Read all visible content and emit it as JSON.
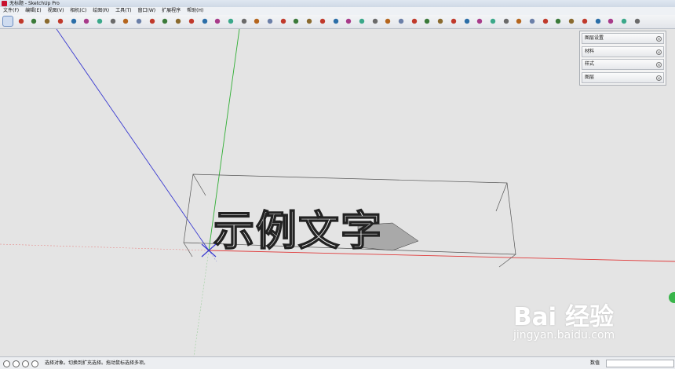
{
  "window": {
    "title": "无标题 - SketchUp Pro"
  },
  "menu": [
    {
      "label": "文件(F)"
    },
    {
      "label": "编辑(E)"
    },
    {
      "label": "视图(V)"
    },
    {
      "label": "相机(C)"
    },
    {
      "label": "绘图(R)"
    },
    {
      "label": "工具(T)"
    },
    {
      "label": "窗口(W)"
    },
    {
      "label": "扩展程序"
    },
    {
      "label": "帮助(H)"
    }
  ],
  "toolbar_icons": [
    "select-arrow-icon",
    "eraser-icon",
    "pencil-icon",
    "dropdown-icon",
    "arc-icon",
    "dropdown-icon",
    "rectangle-icon",
    "dropdown-icon",
    "push-pull-icon",
    "move-icon",
    "rotate-icon",
    "scale-icon",
    "offset-icon",
    "tape-measure-icon",
    "dimension-icon",
    "protractor-icon",
    "orbit-icon",
    "pan-icon",
    "zoom-icon",
    "zoom-extents-icon",
    "warehouse-icon",
    "components-icon",
    "paint-bucket-icon",
    "intersect-icon",
    "views-icon",
    "views-icon",
    "views-icon",
    "views-icon",
    "views-icon",
    "section-icon",
    "section-icon",
    "sandbox-icon",
    "sandbox-icon",
    "sandbox-icon",
    "sandbox-icon",
    "sandbox-icon",
    "sandbox-icon",
    "sandbox-icon",
    "style-icon",
    "style-icon",
    "style-icon",
    "style-icon",
    "style-icon",
    "style-icon",
    "style-icon",
    "style-icon",
    "layers-icon",
    "extension-icon",
    "sketchup-icon"
  ],
  "tray": {
    "panels": [
      {
        "label": "图层设置"
      },
      {
        "label": "材料"
      },
      {
        "label": "样式"
      },
      {
        "label": "图层"
      }
    ]
  },
  "scene": {
    "text_3d": "示例文字"
  },
  "status": {
    "hint": "选择对象。切换到扩充选择。拖动鼠标选择多项。",
    "measurements_label": "数值"
  },
  "watermark": {
    "brand": "Bai  经验",
    "url": "jingyan.baidu.com"
  },
  "colors": {
    "red_axis": "#e03a3a",
    "green_axis": "#2fae33",
    "blue_axis": "#3a3ad0",
    "text_fill": "#f7f7f7",
    "text_edge": "#222222"
  }
}
